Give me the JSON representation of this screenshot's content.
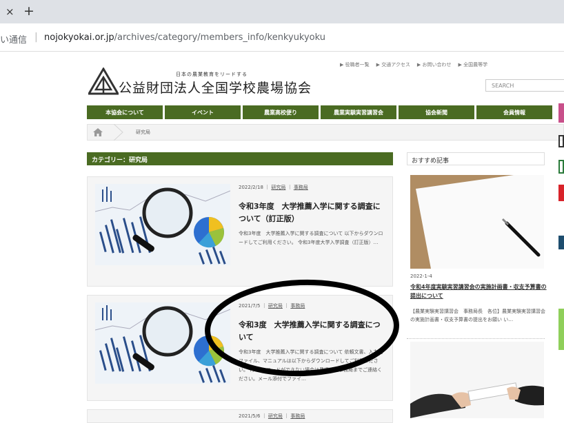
{
  "browser": {
    "close_tab_glyph": "×",
    "new_tab_glyph": "+",
    "security_text": "い通信",
    "url_host": "nojokyokai.or.jp",
    "url_path": "/archives/category/members_info/kenkyukyoku"
  },
  "header": {
    "tagline": "日本の農業教育をリードする",
    "org_name": "公益財団法人全国学校農場協会",
    "top_links": [
      "▶ 役職者一覧",
      "▶ 交通アクセス",
      "▶ お問い合わせ",
      "▶ 全国農等学"
    ],
    "search_placeholder": "SEARCH"
  },
  "nav": {
    "items": [
      "本協会について",
      "イベント",
      "農業高校便り",
      "農業実験実習講習会",
      "協会新聞",
      "会員情報"
    ]
  },
  "breadcrumb": {
    "current": "研究局"
  },
  "category_title": "カテゴリー：研究局",
  "posts": [
    {
      "date": "2022/2/18",
      "cat1": "研究局",
      "cat2": "事務局",
      "title": "令和3年度　大学推薦入学に関する調査について（訂正版）",
      "excerpt": "令和3年度　大学推薦入学に関する調査について 以下からダウンロードしてご利用ください。 令和3年度大学入学調査（訂正版）…"
    },
    {
      "date": "2021/7/5",
      "cat1": "研究局",
      "cat2": "事務局",
      "title": "令和3度　大学推薦入学に関する調査について",
      "excerpt": "令和3年度　大学推薦入学に関する調査について 依頼文書、入力用ファイル、マニュアルは以下からダウンロードしてご利用ください。 (ダウンロードができない場合は農場協会事務局までご連絡ください。メール添付でファイ…"
    },
    {
      "date": "2021/5/6",
      "cat1": "研究局",
      "cat2": "事務局"
    }
  ],
  "sidebar": {
    "heading": "おすすめ記事",
    "featured": {
      "date": "2022-1-4",
      "title": "令和4年度実験実習講習会の実施計画書・収支予算書の提出について",
      "excerpt": "【農業実験実習講習会　事務局長　各位】農業実験実習講習会の実施計画書・収支予算書の提出をお願い い…"
    }
  },
  "colors": {
    "brand_green": "#4a6b22",
    "annotation_ellipse": "#000000"
  }
}
